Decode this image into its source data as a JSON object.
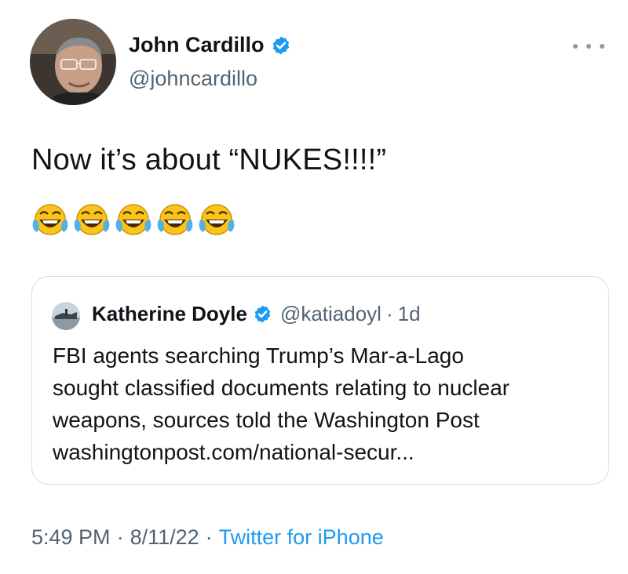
{
  "author": {
    "name": "John Cardillo",
    "handle": "@johncardillo",
    "verified": true
  },
  "tweet": {
    "text": "Now it’s about “NUKES!!!!”",
    "emoji_count": 5,
    "emoji_name": "face-with-tears-of-joy"
  },
  "quoted_tweet": {
    "name": "Katherine Doyle",
    "handle": "@katiadoyl",
    "separator": "·",
    "time": "1d",
    "lines": [
      "FBI agents searching Trump’s Mar-a-Lago",
      "sought classified documents relating to nuclear",
      "weapons, sources told the Washington Post",
      "washingtonpost.com/national-secur..."
    ]
  },
  "footer": {
    "time": "5:49 PM",
    "sep1": "·",
    "date": "8/11/22",
    "sep2": "·",
    "source": "Twitter for iPhone"
  },
  "colors": {
    "text": "#0f1419",
    "secondary": "#536471",
    "link": "#1d9bf0",
    "verified": "#1d9bf0",
    "border": "#d4dde3"
  },
  "icons": [
    "verified-badge-icon",
    "more-options-icon",
    "face-with-tears-of-joy-emoji"
  ]
}
